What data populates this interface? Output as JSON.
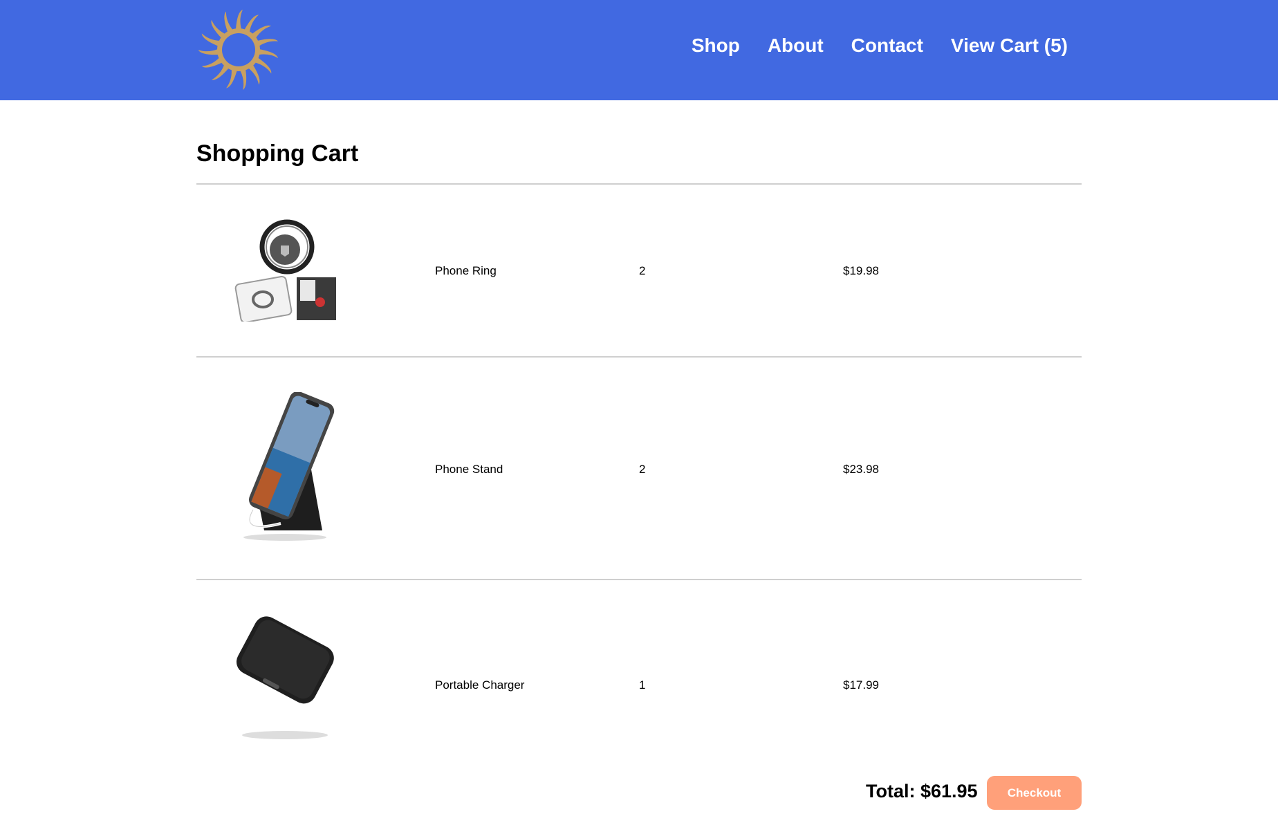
{
  "header": {
    "logo_icon": "sun-logo-icon",
    "nav": [
      {
        "label": "Shop"
      },
      {
        "label": "About"
      },
      {
        "label": "Contact"
      },
      {
        "label": "View Cart (5)"
      }
    ]
  },
  "page_title": "Shopping Cart",
  "cart": {
    "items": [
      {
        "name": "Phone Ring",
        "quantity": "2",
        "price": "$19.98",
        "image_icon": "phone-ring-image"
      },
      {
        "name": "Phone Stand",
        "quantity": "2",
        "price": "$23.98",
        "image_icon": "phone-stand-image"
      },
      {
        "name": "Portable Charger",
        "quantity": "1",
        "price": "$17.99",
        "image_icon": "portable-charger-image"
      }
    ],
    "total_label": "Total: $61.95",
    "checkout_label": "Checkout"
  },
  "colors": {
    "header_bg": "#4169e1",
    "checkout_bg": "#ffa07a",
    "logo_gold": "#c8a060"
  }
}
